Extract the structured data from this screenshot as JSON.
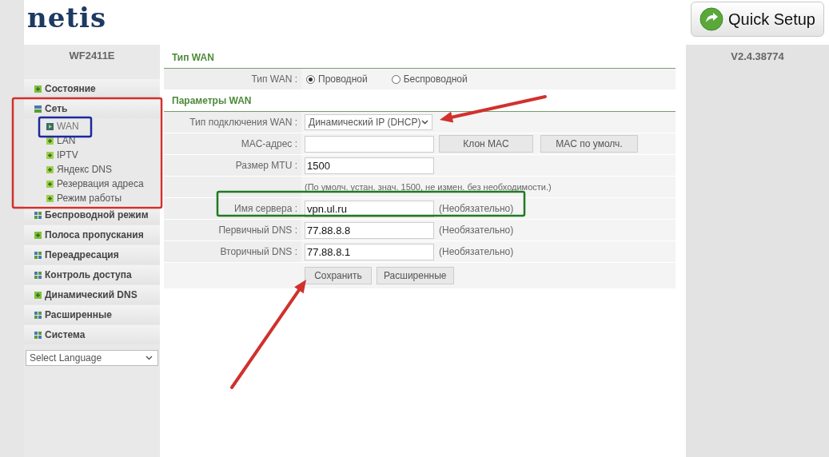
{
  "header": {
    "logo": "netis",
    "quick_setup": "Quick Setup"
  },
  "sidebar": {
    "model": "WF2411E",
    "items": [
      {
        "kind": "leaf",
        "label": "Состояние"
      },
      {
        "kind": "group",
        "label": "Сеть",
        "expanded": true,
        "children": [
          {
            "label": "WAN",
            "selected": true
          },
          {
            "label": "LAN",
            "selected": false
          },
          {
            "label": "IPTV",
            "selected": false
          },
          {
            "label": "Яндекс DNS",
            "selected": false
          },
          {
            "label": "Резервация адреса",
            "selected": false
          },
          {
            "label": "Режим работы",
            "selected": false
          }
        ]
      },
      {
        "kind": "group",
        "label": "Беспроводной режим",
        "expanded": false
      },
      {
        "kind": "leaf",
        "label": "Полоса пропускания"
      },
      {
        "kind": "group",
        "label": "Переадресация",
        "expanded": false
      },
      {
        "kind": "group",
        "label": "Контроль доступа",
        "expanded": false
      },
      {
        "kind": "leaf",
        "label": "Динамический DNS"
      },
      {
        "kind": "group",
        "label": "Расширенные",
        "expanded": false
      },
      {
        "kind": "group",
        "label": "Система",
        "expanded": false
      }
    ],
    "language": "Select Language"
  },
  "sections": [
    {
      "title": "Тип WAN",
      "rows": [
        {
          "kind": "radio",
          "label": "Тип WAN :",
          "options": [
            {
              "label": "Проводной",
              "selected": true
            },
            {
              "label": "Беспроводной",
              "selected": false
            }
          ]
        }
      ]
    },
    {
      "title": "Параметры WAN",
      "rows": [
        {
          "kind": "select",
          "label": "Тип подключения WAN :",
          "value": "Динамический IP (DHCP)"
        },
        {
          "kind": "input",
          "label": "MAC-адрес :",
          "buttons": [
            "Клон MAC",
            "MAC по умолч."
          ]
        },
        {
          "kind": "input",
          "label": "Размер MTU :",
          "value": "1500"
        },
        {
          "kind": "note",
          "text": "(По умолч. устан. знач. 1500, не измен. без необходимости.)"
        },
        {
          "kind": "input",
          "label": "Имя сервера :",
          "value": "vpn.ul.ru",
          "hint": "(Необязательно)"
        },
        {
          "kind": "input",
          "label": "Первичный DNS :",
          "value": "77.88.8.8",
          "hint": "(Необязательно)"
        },
        {
          "kind": "input",
          "label": "Вторичный DNS :",
          "value": "77.88.8.1",
          "hint": "(Необязательно)"
        }
      ]
    }
  ],
  "actions": [
    "Сохранить",
    "Расширенные"
  ],
  "version": "V2.4.38774",
  "annotations": [
    {
      "kind": "frame",
      "color": "#d0312d"
    },
    {
      "kind": "frame",
      "color": "#1c2a9c"
    },
    {
      "kind": "frame",
      "color": "#1f7a22"
    },
    {
      "kind": "arrow",
      "color": "#d0312d"
    },
    {
      "kind": "arrow",
      "color": "#d0312d"
    }
  ]
}
